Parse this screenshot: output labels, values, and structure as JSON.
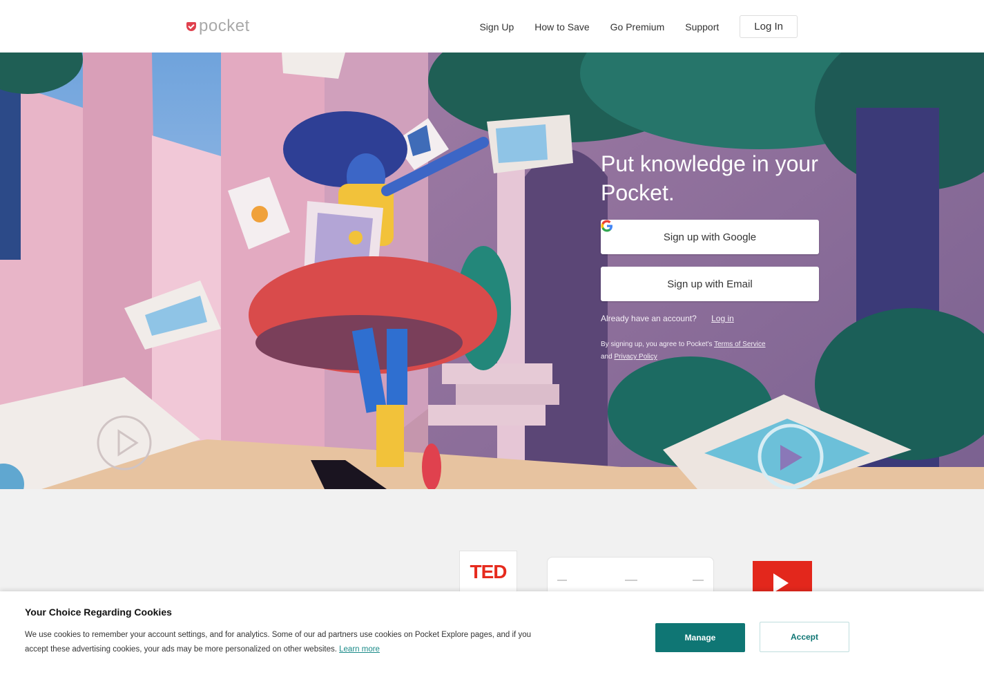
{
  "header": {
    "logo_text": "pocket",
    "nav": [
      "Sign Up",
      "How to Save",
      "Go Premium",
      "Support"
    ],
    "login_label": "Log In"
  },
  "hero": {
    "title": "Put knowledge in your Pocket.",
    "google_button": "Sign up with Google",
    "email_button": "Sign up with Email",
    "already_text": "Already have an account?",
    "login_link": "Log in",
    "legal_prefix": "By signing up, you agree to Pocket's",
    "terms_link": "Terms of Service",
    "legal_and": "and",
    "privacy_link": "Privacy Policy"
  },
  "partners": {
    "ted_text": "TED"
  },
  "cookie": {
    "title": "Your Choice Regarding Cookies",
    "body": "We use cookies to remember your account settings, and for analytics. Some of our ad partners use cookies on Pocket Explore pages, and if you accept these advertising cookies, your ads may be more personalized on other websites.",
    "learn_more": "Learn more",
    "manage_label": "Manage",
    "accept_label": "Accept"
  },
  "colors": {
    "brand_red": "#e0414e",
    "teal": "#0f7674",
    "hero_bg": "#c08aa3"
  },
  "icons": [
    "pocket-logo-icon",
    "google-g-icon",
    "play-icon"
  ]
}
